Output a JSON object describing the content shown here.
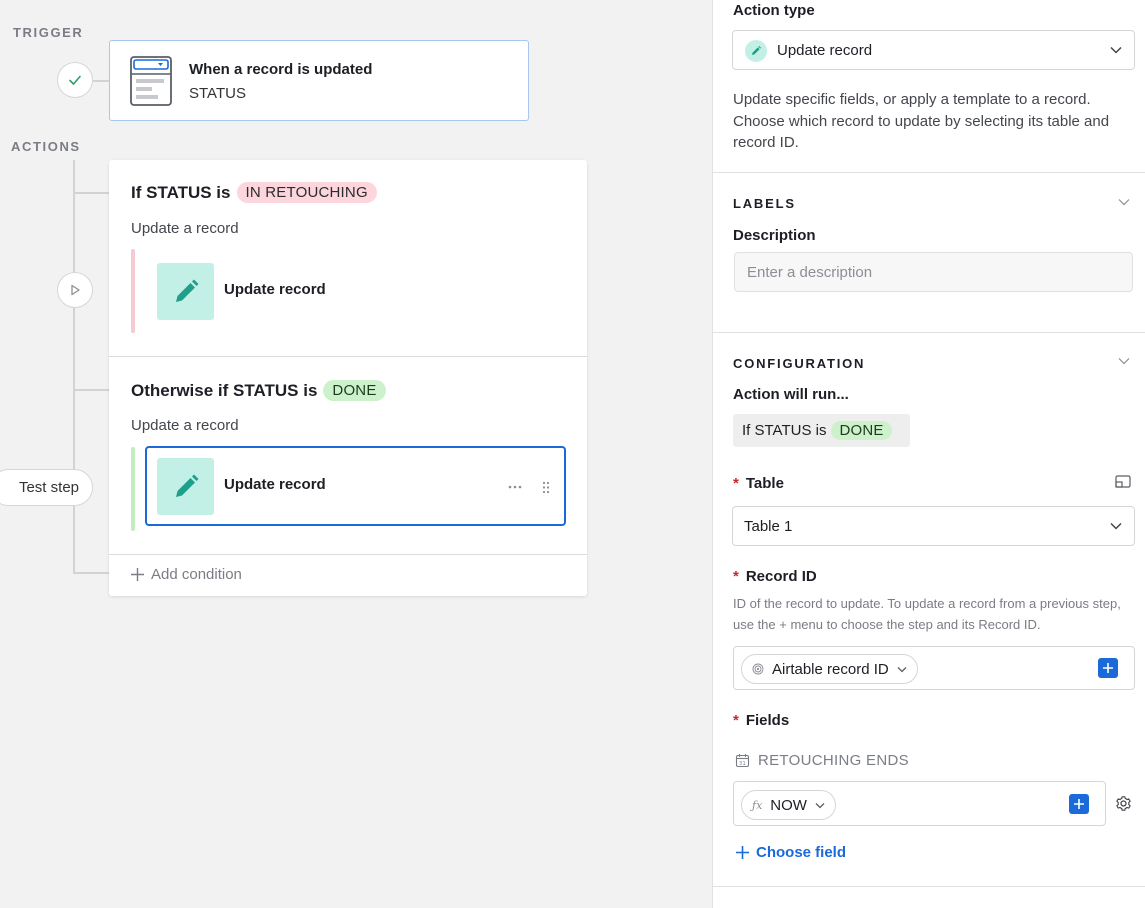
{
  "canvas": {
    "trigger_label": "TRIGGER",
    "actions_label": "ACTIONS",
    "trigger": {
      "title": "When a record is updated",
      "subtitle": "STATUS"
    },
    "conditions": [
      {
        "prefix": "If STATUS is",
        "value": "IN RETOUCHING",
        "value_color": "#fcd6dc",
        "subtitle": "Update a record",
        "action_label": "Update record",
        "bar_color": "#f7c9d1"
      },
      {
        "prefix": "Otherwise if STATUS is",
        "value": "DONE",
        "value_color": "#cdf2cb",
        "subtitle": "Update a record",
        "action_label": "Update record",
        "bar_color": "#c4ecc0"
      }
    ],
    "add_condition_label": "Add condition",
    "test_step_label": "Test step"
  },
  "panel": {
    "action_type_label": "Action type",
    "action_type_value": "Update record",
    "description_text": "Update specific fields, or apply a template to a record. Choose which record to update by selecting its table and record ID.",
    "labels_section": "LABELS",
    "description_label": "Description",
    "description_placeholder": "Enter a description",
    "configuration_section": "CONFIGURATION",
    "action_will_run": "Action will run...",
    "run_prefix": "If STATUS is",
    "run_value": "DONE",
    "table_label": "Table",
    "table_value": "Table 1",
    "record_id_label": "Record ID",
    "record_id_help": "ID of the record to update. To update a record from a previous step, use the + menu to choose the step and its Record ID.",
    "record_id_chip": "Airtable record ID",
    "fields_label": "Fields",
    "field_name": "RETOUCHING ENDS",
    "field_value_chip": "NOW",
    "choose_field_label": "Choose field"
  },
  "colors": {
    "accent": "#1a6ad9",
    "action_icon_bg": "#c2f0e6",
    "action_icon_fg": "#1f9e8a",
    "required": "#c9262b"
  }
}
